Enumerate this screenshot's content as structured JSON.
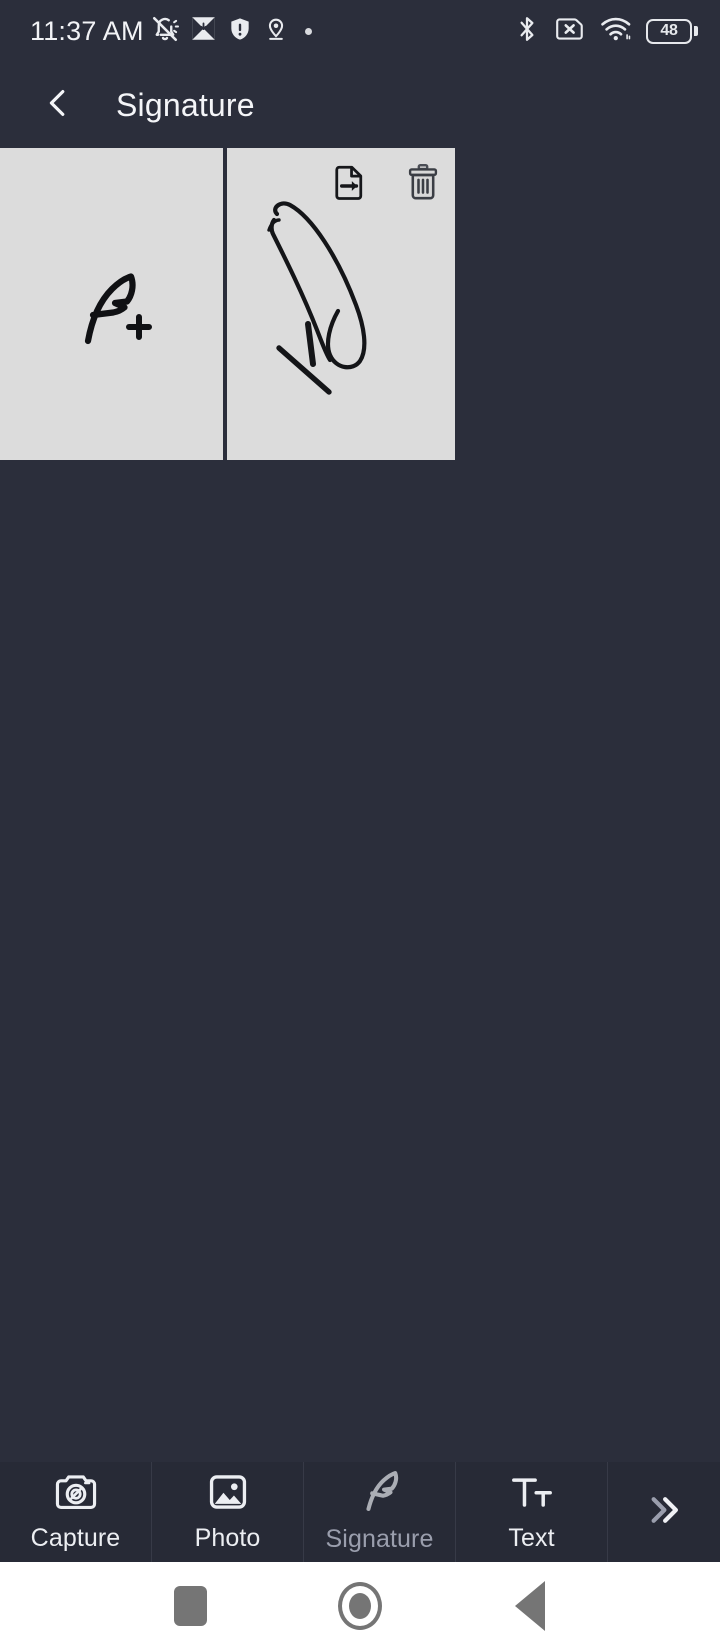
{
  "status_bar": {
    "time": "11:37 AM",
    "battery_percent": "48",
    "left_icons": [
      {
        "name": "bell-muted-icon"
      },
      {
        "name": "image-download-icon"
      },
      {
        "name": "shield-warning-icon"
      },
      {
        "name": "location-pin-icon"
      },
      {
        "name": "dot-indicator-icon"
      }
    ],
    "right_icons": [
      {
        "name": "bluetooth-icon"
      },
      {
        "name": "sim-card-missing-icon"
      },
      {
        "name": "wifi-icon"
      },
      {
        "name": "battery-icon"
      }
    ]
  },
  "app_bar": {
    "back_icon": "chevron-left-icon",
    "title": "Signature"
  },
  "signature_list": {
    "add_card": {
      "icon": "feather-plus-icon",
      "label": "Add signature"
    },
    "items": [
      {
        "icon": "signature-drawing",
        "export_icon": "document-export-icon",
        "delete_icon": "trash-icon"
      }
    ]
  },
  "toolbar": {
    "items": [
      {
        "label": "Capture",
        "icon": "camera-icon",
        "active": false
      },
      {
        "label": "Photo",
        "icon": "image-icon",
        "active": false
      },
      {
        "label": "Signature",
        "icon": "feather-icon",
        "active": true
      },
      {
        "label": "Text",
        "icon": "text-size-icon",
        "active": false
      }
    ],
    "more_icon": "chevron-double-right-icon"
  },
  "nav_bar": {
    "recents_icon": "square-icon",
    "home_icon": "circle-icon",
    "back_icon": "triangle-back-icon"
  },
  "colors": {
    "background": "#2b2e3b",
    "toolbar": "#272a36",
    "card": "#dcdcdc",
    "text": "#f2f3f6",
    "muted_text": "#9a9ead",
    "navbar": "#ffffff"
  }
}
